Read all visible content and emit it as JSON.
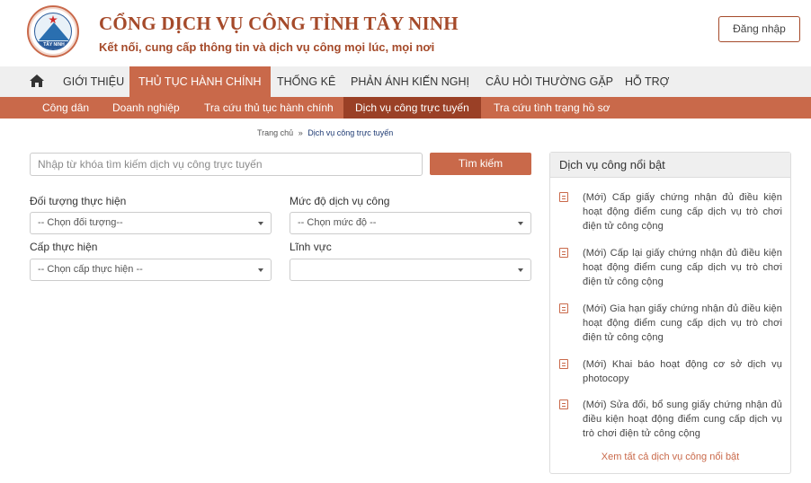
{
  "header": {
    "title": "CỔNG DỊCH VỤ CÔNG TỈNH TÂY NINH",
    "subtitle": "Kết nối, cung cấp thông tin và dịch vụ công mọi lúc, mọi nơi",
    "logo_text": "TÂY NINH",
    "login_label": "Đăng nhập"
  },
  "main_nav": {
    "items": [
      {
        "label": "GIỚI THIỆU"
      },
      {
        "label": "THỦ TỤC HÀNH CHÍNH"
      },
      {
        "label": "THỐNG KÊ"
      },
      {
        "label": "PHẢN ÁNH KIẾN NGHỊ"
      },
      {
        "label": "CÂU HỎI THƯỜNG GẶP"
      },
      {
        "label": "HỖ TRỢ"
      }
    ],
    "active_index": 1
  },
  "sub_nav": {
    "items": [
      {
        "label": "Công dân"
      },
      {
        "label": "Doanh nghiệp"
      },
      {
        "label": "Tra cứu thủ tục hành chính"
      },
      {
        "label": "Dịch vụ công trực tuyến"
      },
      {
        "label": "Tra cứu tình trạng hồ sơ"
      }
    ],
    "active_index": 3
  },
  "breadcrumb": {
    "home": "Trang chủ",
    "separator": "»",
    "current": "Dịch vụ công trực tuyến"
  },
  "search": {
    "placeholder": "Nhập từ khóa tìm kiếm dịch vụ công trực tuyến",
    "value": "",
    "button_label": "Tìm kiếm"
  },
  "filters": {
    "subject": {
      "label": "Đối tượng thực hiện",
      "value": "-- Chọn đối tượng--"
    },
    "level": {
      "label": "Mức độ dịch vụ công",
      "value": "-- Chọn mức độ --"
    },
    "authority": {
      "label": "Cấp thực hiện",
      "value": "-- Chọn cấp thực hiện --"
    },
    "field": {
      "label": "Lĩnh vực",
      "value": ""
    }
  },
  "featured": {
    "title": "Dịch vụ công nổi bật",
    "items": [
      {
        "text": "(Mới) Cấp giấy chứng nhận đủ điều kiện hoạt động điểm cung cấp dịch vụ trò chơi điện tử công cộng"
      },
      {
        "text": "(Mới) Cấp lại giấy chứng nhận đủ điều kiện hoạt động điểm cung cấp dịch vụ trò chơi điện tử công cộng"
      },
      {
        "text": "(Mới) Gia hạn giấy chứng nhận đủ điều kiện hoạt động điểm cung cấp dịch vụ trò chơi điện tử công cộng"
      },
      {
        "text": "(Mới) Khai báo hoạt động cơ sở dịch vụ photocopy"
      },
      {
        "text": "(Mới) Sửa đổi, bổ sung giấy chứng nhận đủ điều kiện hoạt động điểm cung cấp dịch vụ trò chơi điện tử công cộng"
      }
    ],
    "see_all": "Xem tất cả dịch vụ công nổi bật"
  },
  "colors": {
    "brand": "#c9694a",
    "brand_dark": "#9a4026",
    "title": "#a54a2a"
  }
}
